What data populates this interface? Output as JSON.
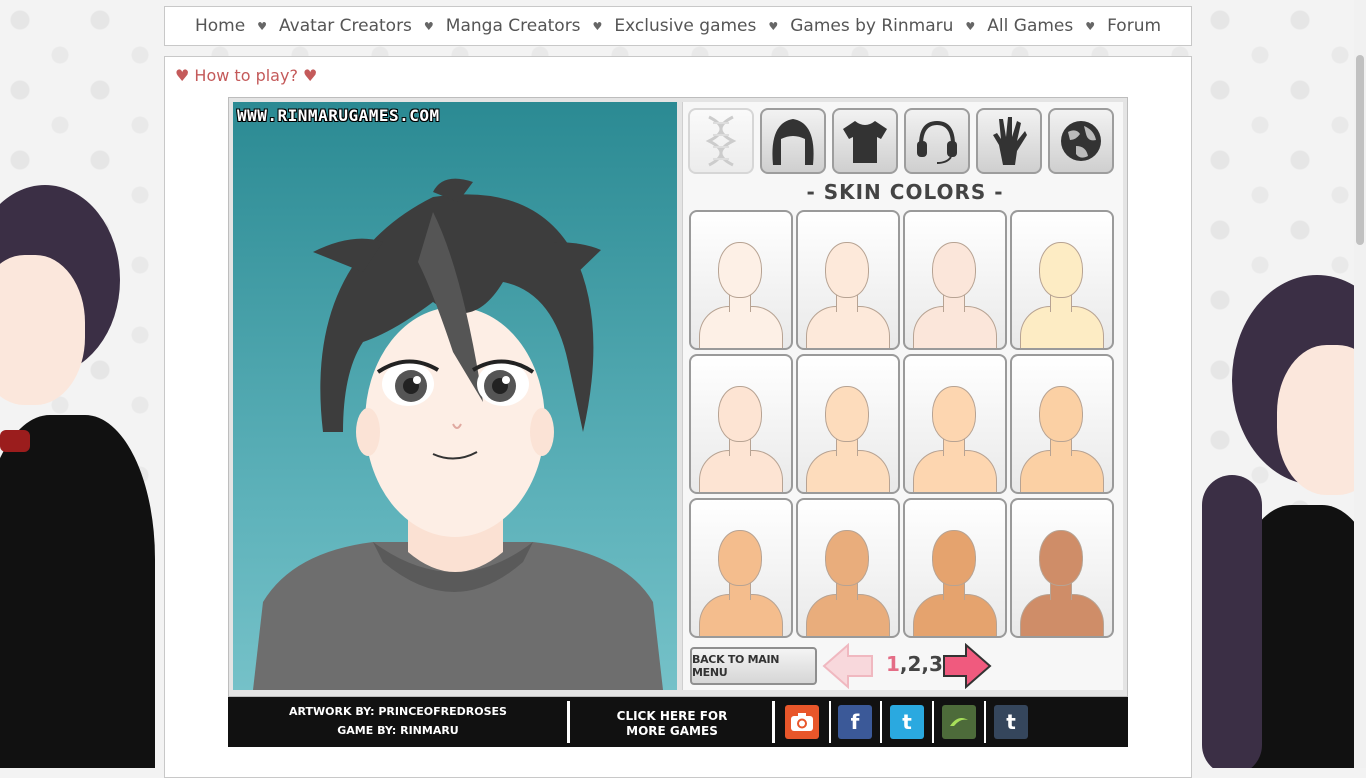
{
  "nav": {
    "items": [
      "Home",
      "Avatar Creators",
      "Manga Creators",
      "Exclusive games",
      "Games by Rinmaru",
      "All Games",
      "Forum"
    ],
    "separator": "♥"
  },
  "howto": "♥ How to play? ♥",
  "game": {
    "watermark": "WWW.RINMARUGAMES.COM",
    "categories": [
      "dna-icon",
      "hair-icon",
      "shirt-icon",
      "headphones-icon",
      "hand-icon",
      "globe-icon"
    ],
    "section_title": "- SKIN COLORS -",
    "skin_colors": [
      "#fdf0e6",
      "#fde9da",
      "#fbe6da",
      "#fdecc4",
      "#fde4d3",
      "#fddcbc",
      "#fdd6b0",
      "#fbd0a4",
      "#f4bd8d",
      "#e9ad7c",
      "#e5a36e",
      "#cf8d68"
    ],
    "back_button": "BACK TO MAIN MENU",
    "pages": {
      "current": "1",
      "rest": ",2,3"
    },
    "credits": {
      "artwork": "ARTWORK BY: PRINCEOFREDROSES",
      "game": "GAME BY: RINMARU"
    },
    "more_games": {
      "line1": "CLICK HERE FOR",
      "line2": "MORE GAMES"
    },
    "social": {
      "facebook": "f",
      "twitter": "t",
      "tumblr": "t"
    }
  },
  "colors": {
    "accent": "#c45a5a",
    "arrow": "#f05a7e",
    "stage_top": "#2b8a93"
  }
}
